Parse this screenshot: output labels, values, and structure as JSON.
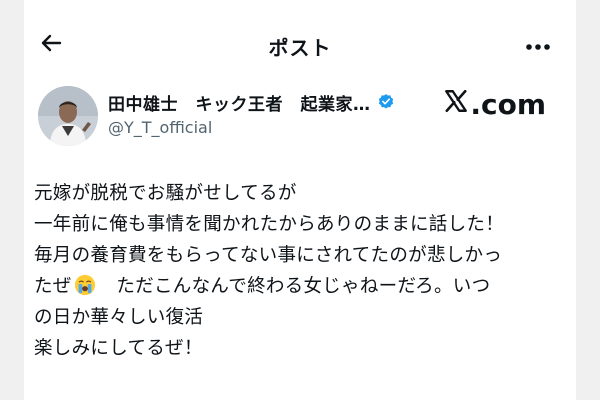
{
  "header": {
    "title": "ポスト",
    "back_icon": "arrow-left-icon",
    "more_icon": "more-horizontal-icon"
  },
  "author": {
    "name": "田中雄士　キック王者　起業家…",
    "handle": "@Y_T_official",
    "verified_icon": "verified-badge-icon",
    "verified_color": "#1d9bf0"
  },
  "watermark": {
    "text": ".com",
    "logo": "x-logo-icon"
  },
  "post": {
    "lines": [
      "元嫁が脱税でお騒がせしてるが",
      "一年前に俺も事情を聞かれたからありのままに話した！",
      "毎月の養育費をもらってない事にされてたのが悲しかっ",
      "たぜ",
      "　ただこんなんで終わる女じゃねーだろ。いつ",
      "の日か華々しい復活",
      "楽しみにしてるぜ！"
    ],
    "emoji": "loudly-crying-face-icon"
  }
}
